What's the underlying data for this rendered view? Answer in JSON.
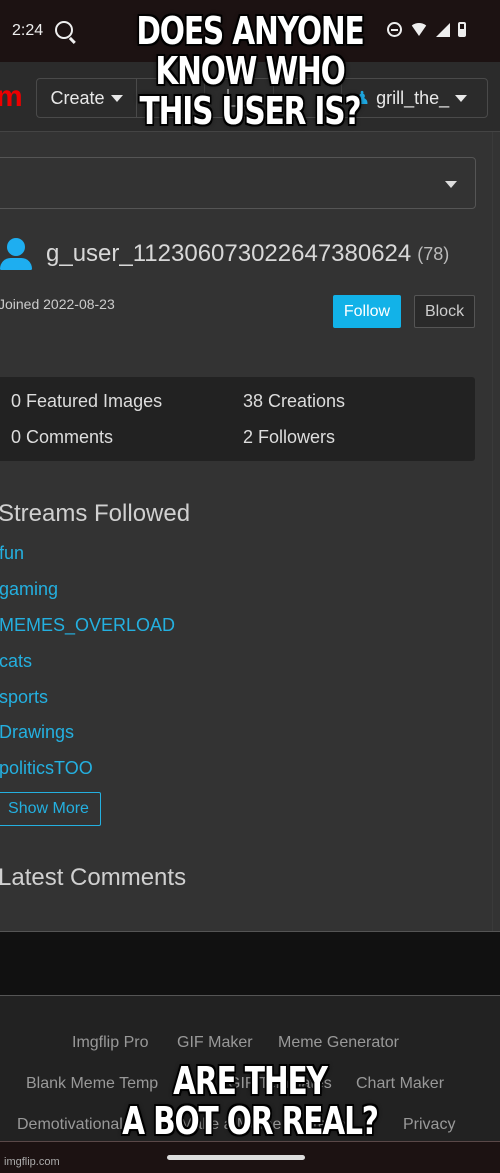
{
  "status_bar": {
    "time": "2:24",
    "icons": [
      "search-q-icon",
      "do-not-disturb-icon",
      "wifi-icon",
      "cell-signal-icon",
      "battery-icon"
    ]
  },
  "nav": {
    "logo_fragment": "m",
    "create_label": "Create",
    "username": "grill_the_"
  },
  "profile": {
    "username": "g_user_112306073022647380624",
    "points": "(78)",
    "joined": "Joined 2022-08-23",
    "follow_label": "Follow",
    "block_label": "Block"
  },
  "stats": {
    "featured_images": "0 Featured Images",
    "creations": "38 Creations",
    "comments": "0 Comments",
    "followers": "2 Followers"
  },
  "streams": {
    "title": "Streams Followed",
    "items": [
      "fun",
      "gaming",
      "MEMES_OVERLOAD",
      "cats",
      "sports",
      "Drawings",
      "politicsTOO"
    ],
    "show_more_label": "Show More"
  },
  "latest_comments": {
    "title": "Latest Comments"
  },
  "footer": {
    "links": [
      "Imgflip Pro",
      "GIF Maker",
      "Meme Generator",
      "Blank Meme Temp",
      "GIF Templates",
      "Chart Maker",
      "Demotivational",
      "Make a Meme",
      "Terms",
      "Privacy"
    ]
  },
  "meme": {
    "top_text": [
      "DOES ANYONE",
      "KNOW WHO",
      "THIS USER IS?"
    ],
    "bottom_text": [
      "ARE THEY",
      "A BOT OR REAL?"
    ]
  },
  "watermark": "imgflip.com",
  "colors": {
    "accent": "#12b2e8",
    "link": "#24b0e0",
    "logo": "#ee0000",
    "background": "#333333"
  }
}
